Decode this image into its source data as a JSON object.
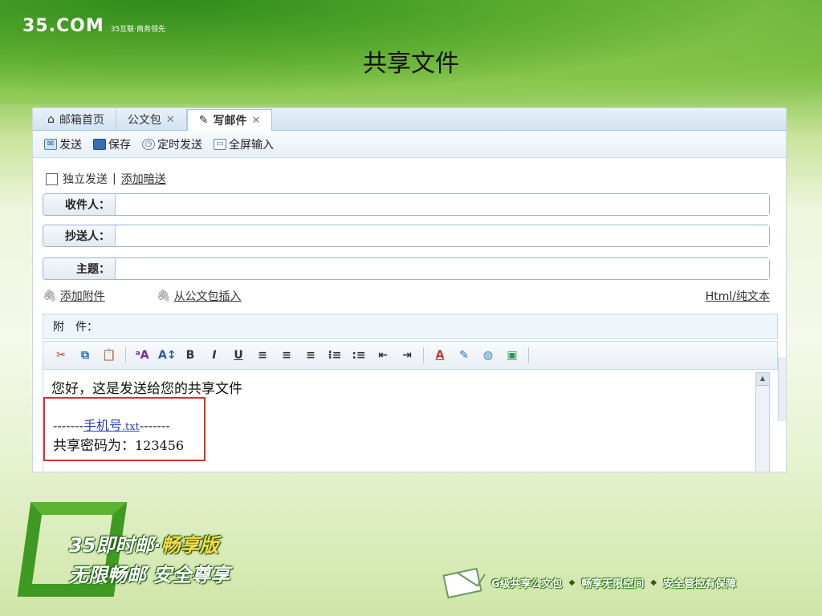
{
  "header": {
    "logo_main": "35.COM",
    "logo_sub": "35互联·商务领先",
    "slide_title": "共享文件"
  },
  "tabs": [
    {
      "label": "邮箱首页",
      "icon": "home-icon",
      "closable": false
    },
    {
      "label": "公文包",
      "icon": "",
      "closable": true
    },
    {
      "label": "写邮件",
      "icon": "pencil-icon",
      "closable": true,
      "active": true
    }
  ],
  "toolbar": {
    "send_label": "发送",
    "save_label": "保存",
    "schedule_label": "定时发送",
    "fullscreen_label": "全屏输入"
  },
  "options": {
    "separate_send_label": "独立发送",
    "separator": "|",
    "add_bcc_label": "添加暗送"
  },
  "fields": {
    "to_label": "收件人：",
    "to_value": "",
    "cc_label": "抄送人：",
    "cc_value": "",
    "subject_label": "主题：",
    "subject_value": ""
  },
  "attach": {
    "add_attachment_label": "添加附件",
    "insert_from_briefcase_label": "从公文包插入",
    "format_toggle_label": "Html/纯文本",
    "attachments_label": "附　件："
  },
  "editor_toolbar": {
    "buttons": [
      "cut-icon",
      "copy-icon",
      "paste-icon",
      "spellcheck-icon",
      "font-size-icon",
      "bold-icon",
      "italic-icon",
      "underline-icon",
      "align-left-icon",
      "align-center-icon",
      "align-right-icon",
      "ordered-list-icon",
      "unordered-list-icon",
      "outdent-icon",
      "indent-icon",
      "font-color-icon",
      "highlight-icon",
      "link-icon",
      "image-icon"
    ]
  },
  "editor": {
    "line1": "您好，这是发送给您的共享文件",
    "dash_left": "-------",
    "file_name": "手机号",
    "file_ext": ".txt",
    "dash_right": "-------",
    "password_label": "共享密码为：",
    "password_value": "123456"
  },
  "branding": {
    "slogan_line1_prefix": "35即时邮·",
    "slogan_line1_highlight": "畅享版",
    "slogan_line2": "无限畅邮 安全尊享",
    "footer_items": [
      "G级共享公文包",
      "畅享无限空间",
      "安全管控有保障"
    ],
    "footer_separator": "◆"
  },
  "colors": {
    "accent_green": "#3f9a23",
    "highlight_red": "#d9312e",
    "link_blue": "#2b3fb0"
  }
}
